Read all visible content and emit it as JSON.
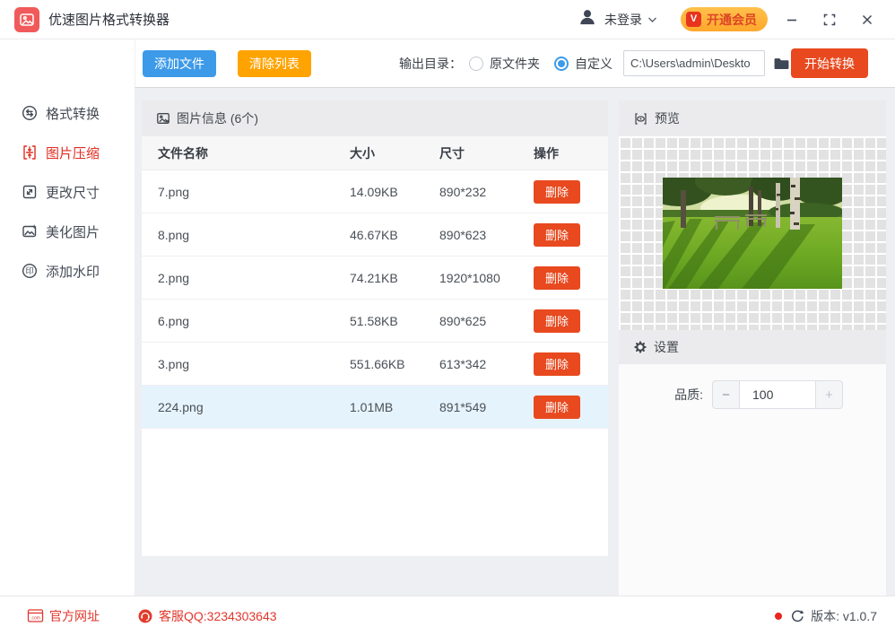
{
  "titlebar": {
    "app_title": "优速图片格式转换器",
    "login_label": "未登录",
    "vip_label": "开通会员",
    "vip_badge": "V"
  },
  "toolbar": {
    "add_files": "添加文件",
    "clear_list": "清除列表",
    "output_dir_label": "输出目录：",
    "radio_original": "原文件夹",
    "radio_custom": "自定义",
    "path_value": "C:\\Users\\admin\\Deskto",
    "start_convert": "开始转换"
  },
  "sidebar": {
    "items": [
      {
        "label": "格式转换",
        "active": false
      },
      {
        "label": "图片压缩",
        "active": true
      },
      {
        "label": "更改尺寸",
        "active": false
      },
      {
        "label": "美化图片",
        "active": false
      },
      {
        "label": "添加水印",
        "active": false
      }
    ]
  },
  "file_panel": {
    "title": "图片信息 (6个)",
    "columns": {
      "name": "文件名称",
      "size": "大小",
      "dims": "尺寸",
      "action": "操作"
    },
    "delete_label": "删除",
    "rows": [
      {
        "name": "7.png",
        "size": "14.09KB",
        "dimensions": "890*232",
        "selected": false
      },
      {
        "name": "8.png",
        "size": "46.67KB",
        "dimensions": "890*623",
        "selected": false
      },
      {
        "name": "2.png",
        "size": "74.21KB",
        "dimensions": "1920*1080",
        "selected": false
      },
      {
        "name": "6.png",
        "size": "51.58KB",
        "dimensions": "890*625",
        "selected": false
      },
      {
        "name": "3.png",
        "size": "551.66KB",
        "dimensions": "613*342",
        "selected": false
      },
      {
        "name": "224.png",
        "size": "1.01MB",
        "dimensions": "891*549",
        "selected": true
      }
    ]
  },
  "preview_panel": {
    "title": "预览"
  },
  "settings_panel": {
    "title": "设置",
    "quality_label": "品质:",
    "quality_value": "100",
    "minus_label": "−",
    "plus_label": "+"
  },
  "statusbar": {
    "website": "官方网址",
    "qq": "客服QQ:3234303643",
    "version": "版本: v1.0.7"
  },
  "colors": {
    "brand_red": "#f15a5a",
    "accent_blue": "#3d9ae8",
    "accent_orange": "#ffa300",
    "action_red": "#e8491f",
    "vip_pill_bg": "#ffb33e",
    "vip_text": "#dd4526",
    "active_nav_red": "#e02e24",
    "link_red": "#e0372c",
    "row_highlight": "#e5f3fc"
  }
}
